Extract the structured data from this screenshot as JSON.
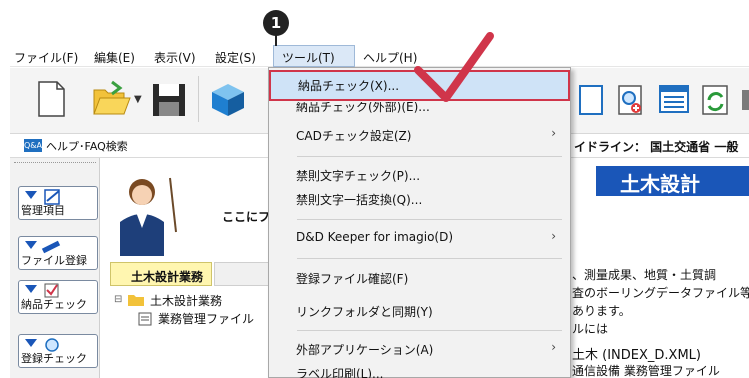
{
  "menubar": {
    "items": [
      "ファイル(F)",
      "編集(E)",
      "表示(V)",
      "設定(S)",
      "ツール(T)",
      "ヘルプ(H)"
    ]
  },
  "tools_menu": {
    "items": [
      {
        "label": "納品チェック(X)...",
        "highlighted": true,
        "submenu": false
      },
      {
        "label": "納品チェック(外部)(E)...",
        "submenu": false
      },
      {
        "label": "CADチェック設定(Z)",
        "submenu": true
      },
      {
        "label": "禁則文字チェック(P)...",
        "submenu": false
      },
      {
        "label": "禁則文字一括変換(Q)...",
        "submenu": false
      },
      {
        "label": "D&D Keeper for imagio(D)",
        "submenu": true
      },
      {
        "label": "登録ファイル確認(F)",
        "submenu": false
      },
      {
        "label": "リンクフォルダと同期(Y)",
        "submenu": false
      },
      {
        "label": "外部アプリケーション(A)",
        "submenu": true
      },
      {
        "label": "ラベル印刷(L)...",
        "submenu": false
      }
    ]
  },
  "help_bar": {
    "badge": "Q&A",
    "label": "ヘルプ･FAQ検索"
  },
  "left_panel": {
    "buttons": [
      "管理項目",
      "ファイル登録",
      "納品チェック",
      "登録チェック"
    ]
  },
  "main": {
    "guideline_text": "イドライン： 国土交通省 一般",
    "title": "土木設計",
    "welcome": "ここにファ",
    "tab_label": "土木設計業務",
    "body_lines": [
      "、測量成果、地質・土質調",
      "査のボーリングデータファイル等",
      "あります。",
      "ルには"
    ],
    "tree_root": "土木設計業務",
    "tree_child": "業務管理ファイル",
    "index_text": "土木 (INDEX_D.XML)",
    "bottom_text": "通信設備 業務管理ファイル"
  },
  "annotation": {
    "step": "1"
  },
  "colors": {
    "accent": "#1a56b8",
    "highlight_border": "#d0354a",
    "title_bg": "#1a56b8",
    "check": "#d0354a"
  }
}
